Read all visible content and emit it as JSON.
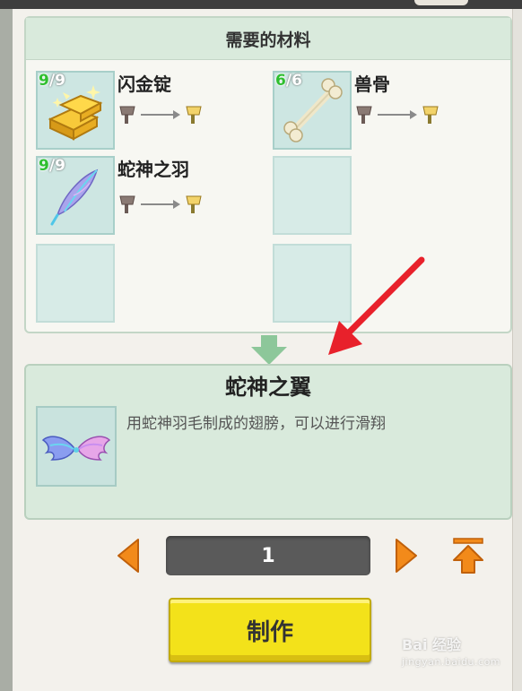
{
  "materials_panel": {
    "title": "需要的材料",
    "items": [
      {
        "name": "闪金锭",
        "have": "9",
        "need": "9",
        "icon": "gold-ingot-icon"
      },
      {
        "name": "兽骨",
        "have": "6",
        "need": "6",
        "icon": "bone-icon"
      },
      {
        "name": "蛇神之羽",
        "have": "9",
        "need": "9",
        "icon": "feather-icon"
      }
    ]
  },
  "result": {
    "name": "蛇神之翼",
    "description": "用蛇神羽毛制成的翅膀，可以进行滑翔",
    "icon": "wings-icon"
  },
  "quantity": {
    "value": "1"
  },
  "craft_button": {
    "label": "制作"
  },
  "watermark": {
    "line1": "Bai 经验",
    "line2": "jingyan.baidu.com"
  },
  "colors": {
    "count_have": "#2fbf2f",
    "arrow_orange": "#f28a1a",
    "craft_yellow": "#f3e21a",
    "panel_green": "#d9eadc",
    "pointer_red": "#e8212b"
  }
}
